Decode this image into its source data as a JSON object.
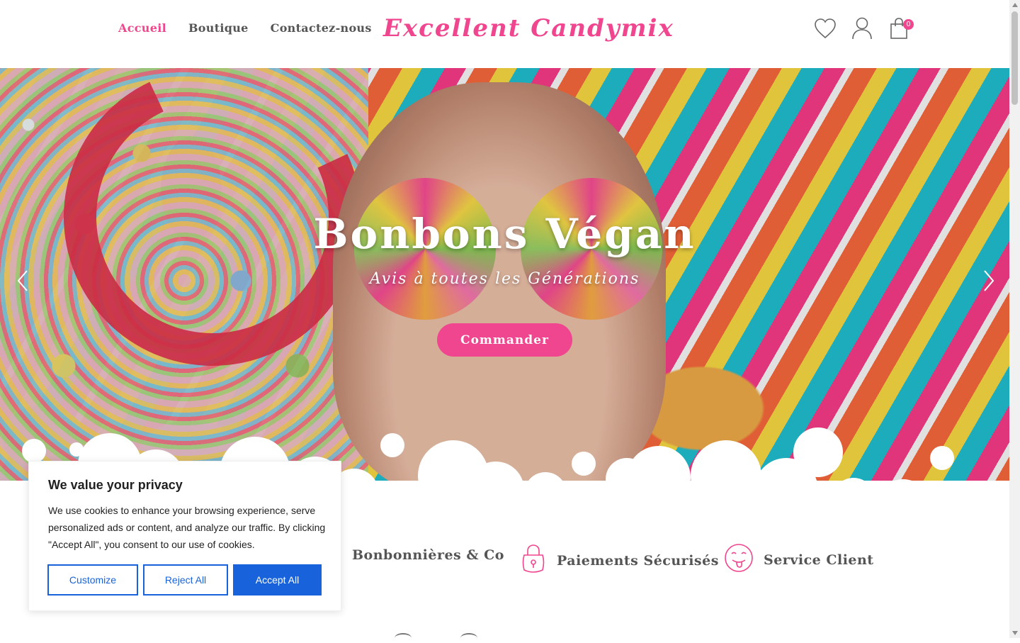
{
  "nav": {
    "items": [
      {
        "label": "Accueil",
        "active": true
      },
      {
        "label": "Boutique",
        "active": false
      },
      {
        "label": "Contactez-nous",
        "active": false
      }
    ]
  },
  "brand": {
    "name": "Excellent Candymix"
  },
  "header_icons": {
    "wishlist": "heart-icon",
    "account": "user-icon",
    "cart": "shopping-bag-icon",
    "cart_count": "0"
  },
  "hero": {
    "title": "Bonbons Végan",
    "subtitle": "Avis à toutes les Générations",
    "cta_label": "Commander"
  },
  "features": [
    {
      "label": "Bonbonnières & Co",
      "icon": "candy-jar-icon"
    },
    {
      "label": "Paiements Sécurisés",
      "icon": "padlock-icon"
    },
    {
      "label": "Service Client",
      "icon": "smiley-tongue-icon"
    }
  ],
  "cookie": {
    "title": "We value your privacy",
    "text": "We use cookies to enhance your browsing experience, serve personalized ads or content, and analyze our traffic. By clicking \"Accept All\", you consent to our use of cookies.",
    "customize_label": "Customize",
    "reject_label": "Reject All",
    "accept_label": "Accept All"
  },
  "colors": {
    "brand_pink": "#f0458f",
    "nav_text": "#555555",
    "cookie_blue": "#1863dc"
  }
}
